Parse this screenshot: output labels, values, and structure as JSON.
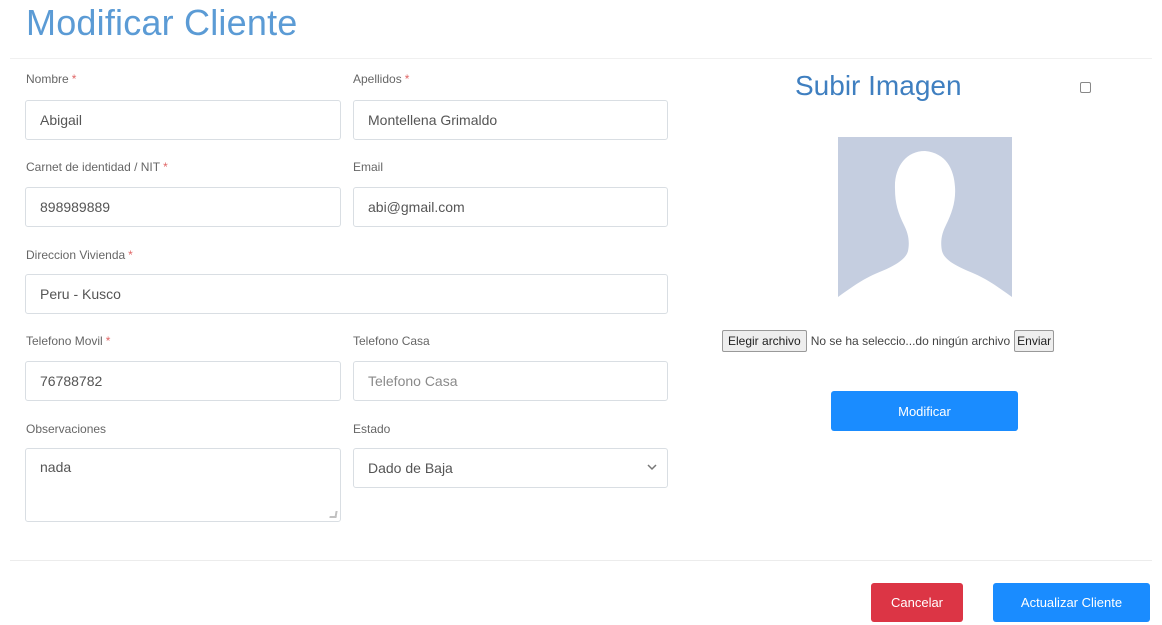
{
  "page": {
    "title": "Modificar Cliente"
  },
  "form": {
    "nombre": {
      "label": "Nombre",
      "value": "Abigail"
    },
    "apellidos": {
      "label": "Apellidos",
      "value": "Montellena Grimaldo"
    },
    "carnet": {
      "label": "Carnet de identidad / NIT",
      "value": "898989889"
    },
    "email": {
      "label": "Email",
      "value": "abi@gmail.com"
    },
    "direccion": {
      "label": "Direccion Vivienda",
      "value": "Peru - Kusco"
    },
    "telefono_movil": {
      "label": "Telefono Movil",
      "value": "76788782"
    },
    "telefono_casa": {
      "label": "Telefono Casa",
      "placeholder": "Telefono Casa"
    },
    "observaciones": {
      "label": "Observaciones",
      "value": "nada"
    },
    "estado": {
      "label": "Estado",
      "value": "Dado de Baja"
    },
    "required_mark": "*"
  },
  "upload": {
    "title": "Subir Imagen",
    "choose_file_label": "Elegir archivo",
    "no_file_text": "No se ha seleccio...do ningún archivo",
    "send_label": "Enviar",
    "modify_label": "Modificar"
  },
  "footer": {
    "cancel_label": "Cancelar",
    "update_label": "Actualizar Cliente"
  },
  "colors": {
    "title": "#5b9bd5",
    "primary": "#1a8cff",
    "danger": "#dc3545",
    "required": "#e06666",
    "avatar_bg": "#c5cee0"
  },
  "icons": {
    "avatar": "user-silhouette-icon",
    "select_caret": "chevron-down-icon"
  }
}
